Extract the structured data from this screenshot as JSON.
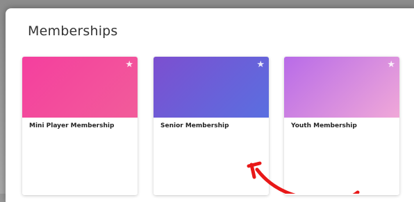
{
  "panel": {
    "title": "Memberships"
  },
  "cards": [
    {
      "name": "Mini Player Membership",
      "gradient_from": "#f43f9e",
      "gradient_to": "#f25c9a"
    },
    {
      "name": "Senior Membership",
      "gradient_from": "#7c4fd0",
      "gradient_to": "#5a6fe0"
    },
    {
      "name": "Youth Membership",
      "gradient_from": "#b86be8",
      "gradient_to": "#f0a8d8"
    }
  ],
  "annotation": {
    "arrow_color": "#e81818"
  }
}
